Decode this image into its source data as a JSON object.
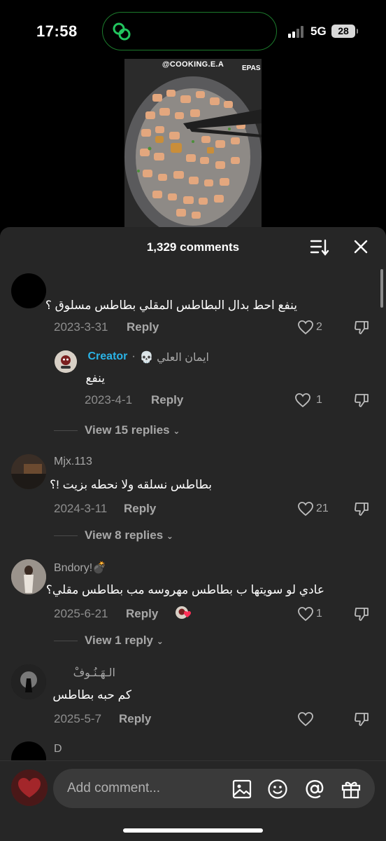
{
  "status_bar": {
    "time": "17:58",
    "network": "5G",
    "battery": "28"
  },
  "video": {
    "handle": "@COOKING.E.A"
  },
  "sheet": {
    "title": "1,329 comments"
  },
  "comments": [
    {
      "username": "",
      "text": "ينفع احط بدال البطاطس المقلي بطاطس مسلوق ؟",
      "date": "2023-3-31",
      "reply": "Reply",
      "likes": "2",
      "view_replies": "View 15 replies"
    },
    {
      "username": "Mjx.113",
      "text": "بطاطس نسلقه ولا نحطه بزيت !؟",
      "date": "2024-3-11",
      "reply": "Reply",
      "likes": "21",
      "view_replies": "View 8 replies"
    },
    {
      "username": "Bndory!💣",
      "text": "عادي لو سويتها ب بطاطس مهروسه مب بطاطس مقلي؟",
      "date": "2025-6-21",
      "reply": "Reply",
      "likes": "1",
      "view_replies": "View 1 reply"
    },
    {
      "username": "الـهَـنُـوفْ",
      "text": "كم حبه بطاطس",
      "date": "2025-5-7",
      "reply": "Reply",
      "likes": ""
    },
    {
      "username": "D"
    }
  ],
  "creator_reply": {
    "username": "ايمان العلي 💀",
    "separator": "·",
    "badge": "Creator",
    "text": "ينفع",
    "date": "2023-4-1",
    "reply": "Reply",
    "likes": "1"
  },
  "composer": {
    "placeholder": "Add comment..."
  },
  "colors": {
    "creator_badge": "#2ab3e6",
    "island_border": "#1c7a2c",
    "heart_emoji": "#ff2d55"
  }
}
